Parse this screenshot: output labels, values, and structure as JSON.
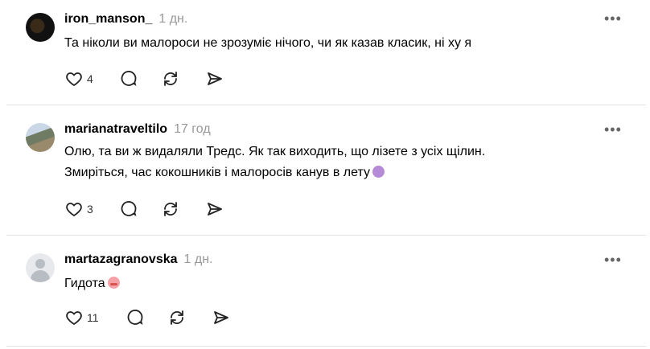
{
  "comments": [
    {
      "username": "iron_manson_",
      "time": "1 дн.",
      "text_lines": [
        "Та ніколи ви малороси не зрозуміє нічого, чи як казав класик, ні ху я"
      ],
      "likes": "4"
    },
    {
      "username": "marianatraveltilo",
      "time": "17 год",
      "text_lines": [
        "Олю, та ви ж видаляли Тредс. Як так виходить, що лізете з усіх щілин.",
        "Змиріться, час кокошників і малоросів канув в лету"
      ],
      "likes": "3",
      "emoji": "shrug-emoji"
    },
    {
      "username": "martazagranovska",
      "time": "1 дн.",
      "text_lines": [
        "Гидота"
      ],
      "likes": "11",
      "emoji": "disgust-face-emoji"
    }
  ],
  "more_label": "•••",
  "icons": [
    "heart-icon",
    "comment-icon",
    "repost-icon",
    "share-icon",
    "more-icon"
  ]
}
